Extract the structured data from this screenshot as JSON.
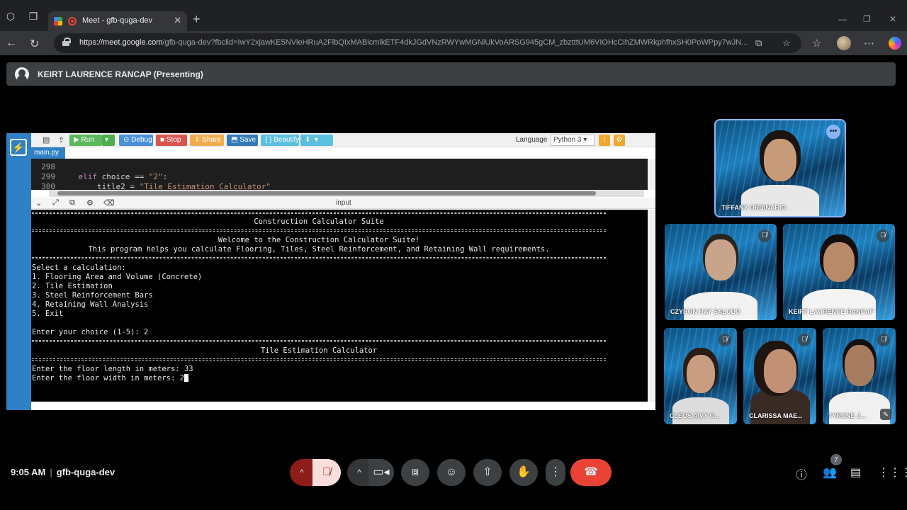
{
  "browser": {
    "tab_title": "Meet - gfb-quga-dev",
    "url_domain": "https://meet.google.com",
    "url_path": "/gfb-quga-dev?fbclid=IwY2xjawKE5NVleHRuA2FlbQIxMABicmlkETF4dkJGdVNzRWYwMGNiUkVoARSG945gCM_zbztttUM6VIOHcCihZMWRkphfhxSH0PoWPpy7wJN...",
    "close_label": "✕",
    "new_tab_label": "+"
  },
  "meet": {
    "presenter_label": "KEIRT LAURENCE RANCAP (Presenting)",
    "time": "9:05 AM",
    "meeting_code": "gfb-quga-dev",
    "participant_count": "7"
  },
  "editor": {
    "buttons": {
      "run": "▶ Run",
      "debug": "⊙ Debug",
      "stop": "■ Stop",
      "share": "⇪ Share",
      "save": "⬒ Save",
      "beautify": "{ } Beautify"
    },
    "language_label": "Language",
    "language_value": "Python 3",
    "file_tab": "main.py",
    "code_lines": [
      {
        "num": "298",
        "code": ""
      },
      {
        "num": "299",
        "kw": "    elif",
        "code": " choice == ",
        "str": "\"2\"",
        "tail": ":"
      },
      {
        "num": "300",
        "code": "        title2 = ",
        "str": "\"Tile Estimation Calculator\"",
        "tail": ""
      }
    ],
    "io_label": "input"
  },
  "console": {
    "title": "Construction Calculator Suite",
    "welcome": "Welcome to the Construction Calculator Suite!",
    "description": "This program helps you calculate Flooring, Tiles, Steel Reinforcement, and Retaining Wall requirements.",
    "menu_header": "Select a calculation:",
    "menu_items": [
      "1. Flooring Area and Volume (Concrete)",
      "2. Tile Estimation",
      "3. Steel Reinforcement Bars",
      "4. Retaining Wall Analysis",
      "5. Exit"
    ],
    "choice_prompt": "Enter your choice (1-5): 2",
    "section_title": "Tile Estimation Calculator",
    "length_prompt": "Enter the floor length in meters: 33",
    "width_prompt": "Enter the floor width in meters: 2"
  },
  "participants": [
    {
      "name": "TIFFANY ORDINARIO",
      "speaking": true,
      "skin": "#c79a7a",
      "hair": "#1b1410",
      "shirt": "#e8e8e8"
    },
    {
      "name": "CZYRON RAY SALUDO",
      "speaking": false,
      "skin": "#c8a48a",
      "hair": "#2a2420",
      "shirt": "#f2f2f2"
    },
    {
      "name": "KEIRT LAURENCE RANCAP",
      "speaking": false,
      "skin": "#b98a6a",
      "hair": "#140e0c",
      "shirt": "#f4f4f4"
    },
    {
      "name": "CLEOS AIVY O...",
      "speaking": false,
      "skin": "#c99d82",
      "hair": "#2b1d16",
      "shirt": "#dcdcdc"
    },
    {
      "name": "CLARISSA MAE...",
      "speaking": false,
      "skin": "#c29074",
      "hair": "#1f1410",
      "shirt": "#3a2a24"
    },
    {
      "name": "TYRONE J...",
      "speaking": false,
      "skin": "#a77d62",
      "hair": "#151010",
      "shirt": "#f0f0f0"
    }
  ],
  "colors": {
    "accent": "#8ab4f8",
    "end_call": "#ea4335",
    "run_green": "#5cb85c",
    "debug_blue": "#4a90d9",
    "stop_red": "#d9534f",
    "share_orange": "#f0ad4e",
    "save_blue": "#337ab7",
    "beautify_cyan": "#5bc0de"
  }
}
